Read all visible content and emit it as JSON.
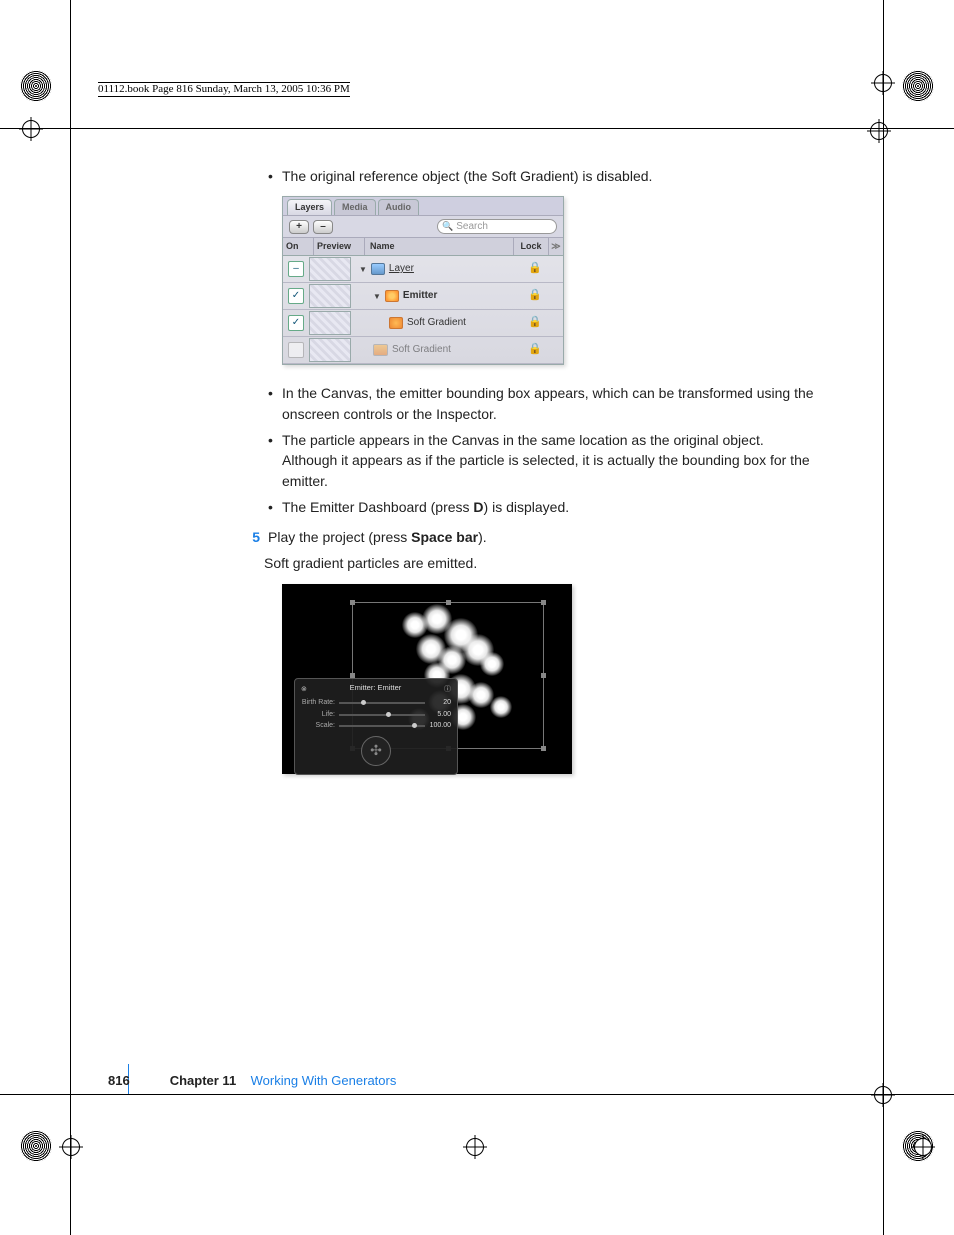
{
  "meta": {
    "header": "01112.book  Page 816  Sunday, March 13, 2005  10:36 PM"
  },
  "body": {
    "bullet_intro": "The original reference object (the Soft Gradient) is disabled.",
    "bullets2": [
      "In the Canvas, the emitter bounding box appears, which can be transformed using the onscreen controls or the Inspector.",
      "The particle appears in the Canvas in the same location as the original object. Although it appears as if the particle is selected, it is actually the bounding box for the emitter."
    ],
    "bullets3_pre": "The Emitter Dashboard (press ",
    "bullets3_key": "D",
    "bullets3_post": ") is displayed.",
    "step5_num": "5",
    "step5_pre": "Play the project (press ",
    "step5_key": "Space bar",
    "step5_post": ").",
    "result": "Soft gradient particles are emitted."
  },
  "panel": {
    "tabs": {
      "layers": "Layers",
      "media": "Media",
      "audio": "Audio"
    },
    "buttons": {
      "add": "+",
      "remove": "–"
    },
    "search_placeholder": "Search",
    "cols": {
      "on": "On",
      "preview": "Preview",
      "name": "Name",
      "lock": "Lock",
      "go": "≫"
    },
    "rows": {
      "layer": "Layer",
      "emitter": "Emitter",
      "softgrad_active": "Soft Gradient",
      "softgrad_disabled": "Soft Gradient"
    },
    "lock_glyph": "🔒"
  },
  "hud": {
    "title": "Emitter: Emitter",
    "rows": [
      {
        "label": "Birth Rate:",
        "value": "20",
        "pos": 25
      },
      {
        "label": "Life:",
        "value": "5.00",
        "pos": 55
      },
      {
        "label": "Scale:",
        "value": "100.00",
        "pos": 85
      }
    ]
  },
  "footer": {
    "page": "816",
    "chapter": "Chapter 11",
    "title": "Working With Generators"
  }
}
